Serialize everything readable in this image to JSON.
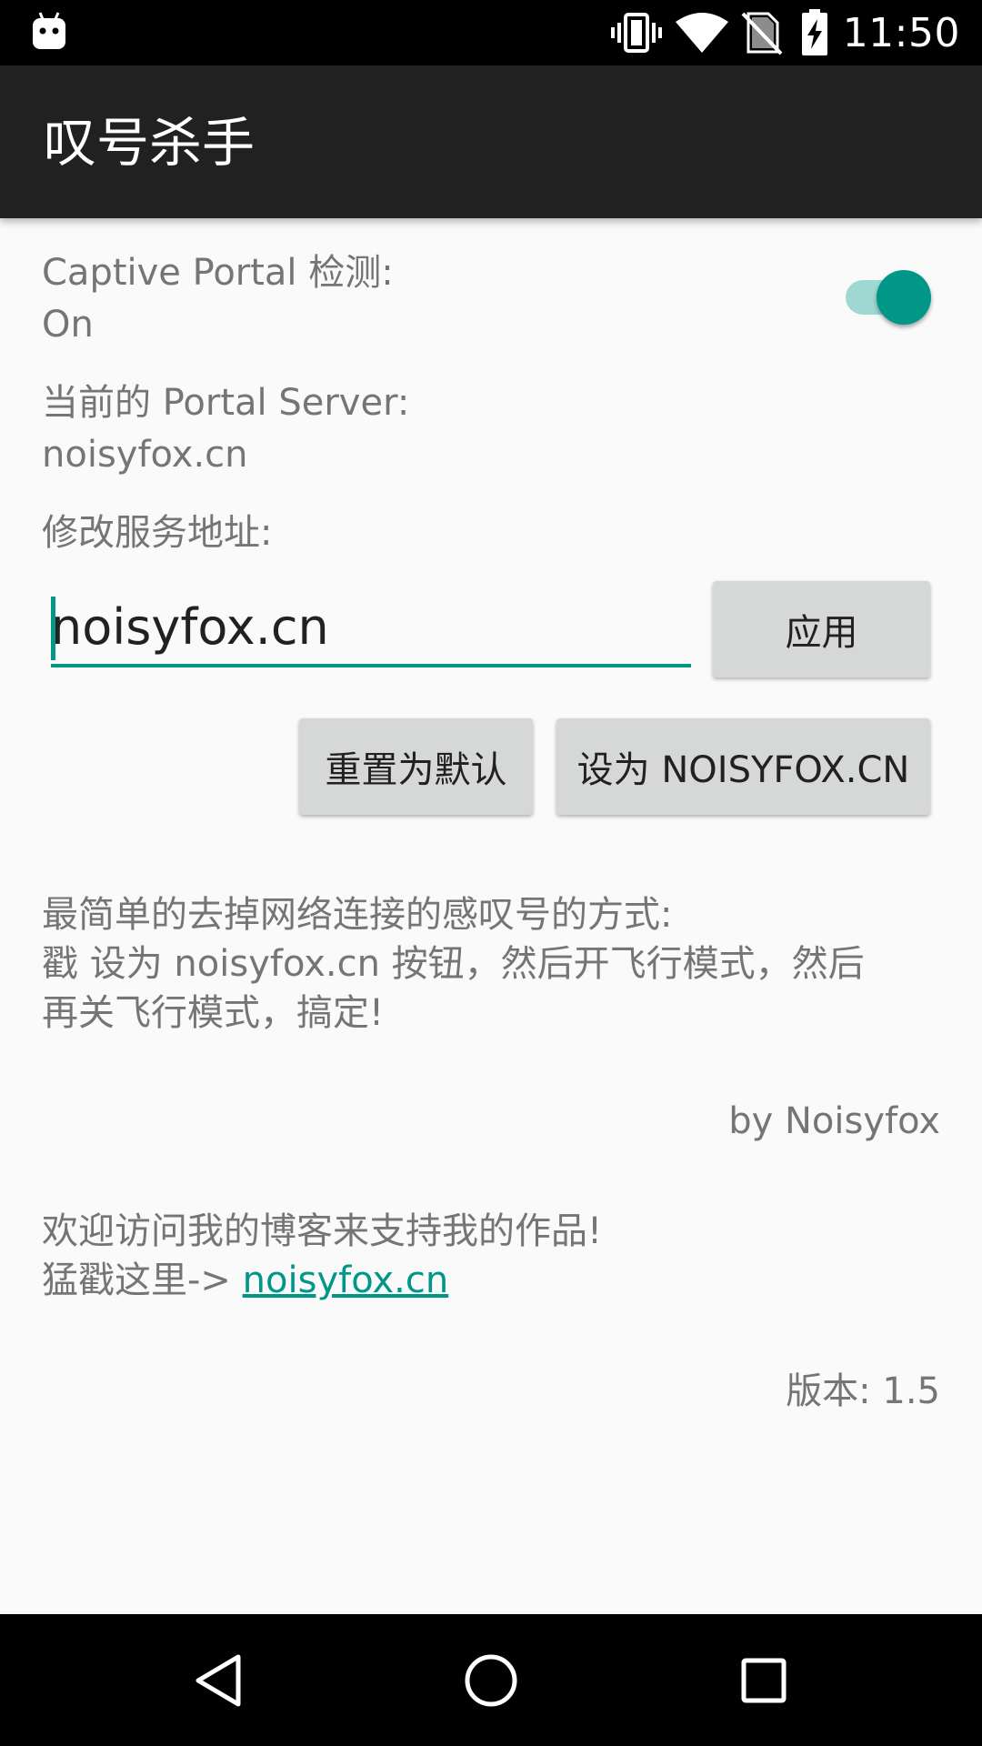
{
  "status_bar": {
    "time": "11:50",
    "icons": [
      "android-robot-icon",
      "vibrate-icon",
      "wifi-icon",
      "no-sim-icon",
      "battery-charging-icon"
    ]
  },
  "app_bar": {
    "title": "叹号杀手"
  },
  "captive_portal": {
    "label": "Captive Portal 检测:",
    "state": "On",
    "switch_on": true
  },
  "portal_server": {
    "label": "当前的 Portal Server:",
    "value": "noisyfox.cn"
  },
  "modify": {
    "label": "修改服务地址:",
    "input_value": "noisyfox.cn",
    "apply_button": "应用",
    "reset_button": "重置为默认",
    "set_button": "设为 NOISYFOX.CN"
  },
  "description": {
    "line1": "最简单的去掉网络连接的感叹号的方式:",
    "line2": "戳 设为 noisyfox.cn 按钮，然后开飞行模式，然后",
    "line3": "再关飞行模式，搞定!"
  },
  "author": "by Noisyfox",
  "blog": {
    "line1": "欢迎访问我的博客来支持我的作品!",
    "prefix": "猛戳这里-> ",
    "link": "noisyfox.cn"
  },
  "version": "版本: 1.5",
  "colors": {
    "accent": "#009688",
    "app_bar": "#212121",
    "background": "#fafafa",
    "button": "#d6d7d7"
  },
  "nav_bar": {
    "icons": [
      "back-icon",
      "home-icon",
      "recents-icon"
    ]
  }
}
